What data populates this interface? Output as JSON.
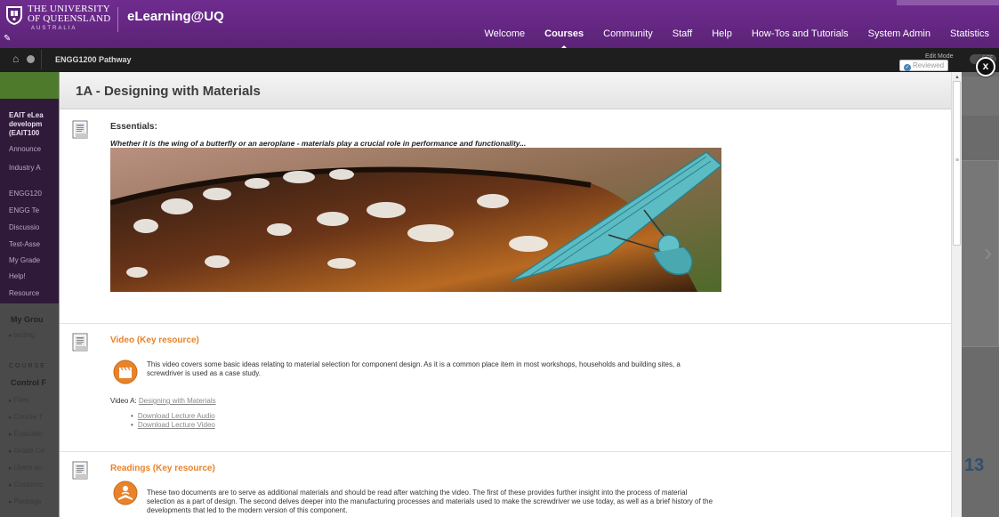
{
  "header": {
    "uni_line1": "THE UNIVERSITY",
    "uni_line2": "OF QUEENSLAND",
    "uni_line3": "AUSTRALIA",
    "app_name": "eLearning@UQ",
    "nav": [
      {
        "label": "Welcome",
        "active": false
      },
      {
        "label": "Courses",
        "active": true
      },
      {
        "label": "Community",
        "active": false
      },
      {
        "label": "Staff",
        "active": false
      },
      {
        "label": "Help",
        "active": false
      },
      {
        "label": "How-Tos and Tutorials",
        "active": false
      },
      {
        "label": "System Admin",
        "active": false
      },
      {
        "label": "Statistics",
        "active": false
      }
    ]
  },
  "breadcrumb": {
    "text": "ENGG1200 Pathway",
    "edit_mode_label": "Edit Mode",
    "edit_mode_state": "OFF"
  },
  "course_menu": {
    "title": "EAIT eLea\ndevelopm\n(EAIT100",
    "items": [
      "Announce",
      "Industry A",
      "ENGG120",
      "ENGG Te",
      "Discussio",
      "Test-Asse",
      "My Grade",
      "Help!",
      "Resource"
    ],
    "my_groups": "My Grou",
    "my_groups_item": "testing",
    "course_label": "COURSE",
    "control_panel": "Control F",
    "control_items": [
      "Files",
      "Course T",
      "Evaluatio",
      "Grade Ce",
      "Users an",
      "Customiz",
      "Package"
    ]
  },
  "background": {
    "right_number": "13"
  },
  "modal": {
    "title": "1A - Designing with Materials",
    "reviewed_label": "Reviewed",
    "close_label": "x",
    "essentials": {
      "title": "Essentials:",
      "subtitle": "Whether it is the wing of a butterfly or an aeroplane - materials play a crucial role in performance and functionality..."
    },
    "video": {
      "title": "Video (Key resource)",
      "description": "This video covers some basic ideas relating to material selection for component design.  As it is a common place item in most workshops, households and building sites, a screwdriver is used as a case study.",
      "link_prefix": "Video A:",
      "link_text": "Designing with Materials",
      "downloads": [
        "Download Lecture Audio",
        "Download Lecture Video"
      ]
    },
    "readings": {
      "title": "Readings (Key resource)",
      "description": "These two documents are to serve as additional materials and should be read after watching the video.  The first of these provides further insight into the process of material selection as a part of design.  The second delves deeper into the manufacturing processes and materials used to make the screwdriver we use today, as well as a brief history of the developments that led to the modern version of this component."
    }
  },
  "colors": {
    "header_purple": "#5b2377",
    "accent_orange": "#e8832a",
    "crumb_bar": "#1e1e1e"
  }
}
